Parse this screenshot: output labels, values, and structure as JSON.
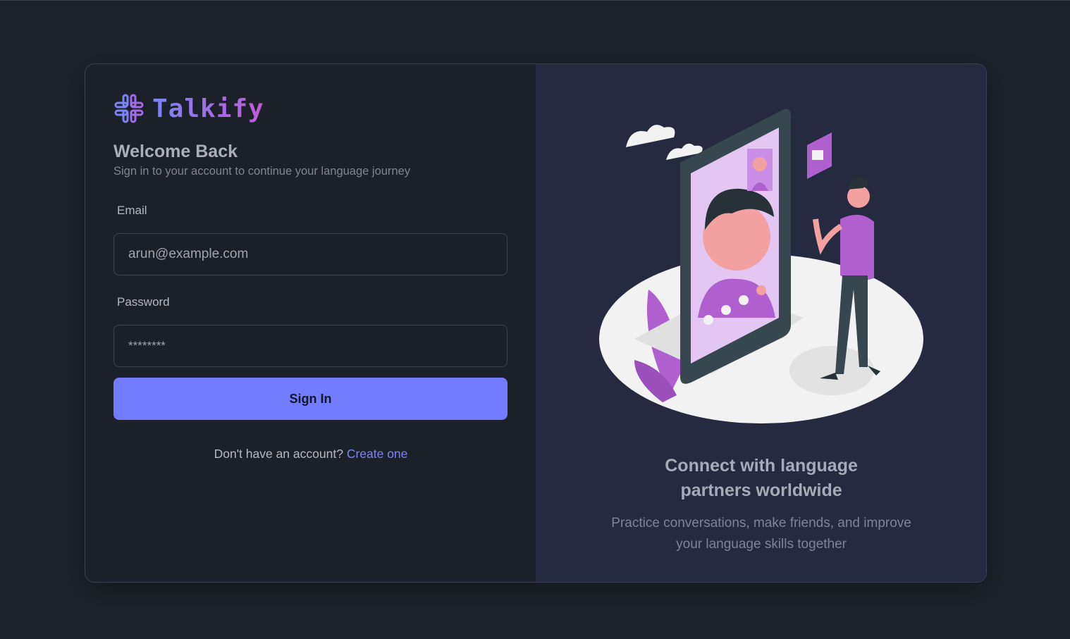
{
  "brand": {
    "name": "Talkify",
    "icon": "slack-like-logo-icon"
  },
  "login": {
    "title": "Welcome Back",
    "subtitle": "Sign in to your account to continue your language journey",
    "email_label": "Email",
    "email_value": "arun@example.com",
    "password_label": "Password",
    "password_value": "********",
    "submit_label": "Sign In",
    "signup_prompt": "Don't have an account?",
    "signup_link": "Create one"
  },
  "promo": {
    "headline": "Connect with language partners worldwide",
    "description": "Practice conversations, make friends, and improve your language skills together",
    "illustration": "video-call-illustration"
  },
  "colors": {
    "accent": "#737cff",
    "brand_gradient_start": "#7b83f7",
    "brand_gradient_end": "#c15ad8",
    "illustration_purple": "#b05fcf"
  }
}
